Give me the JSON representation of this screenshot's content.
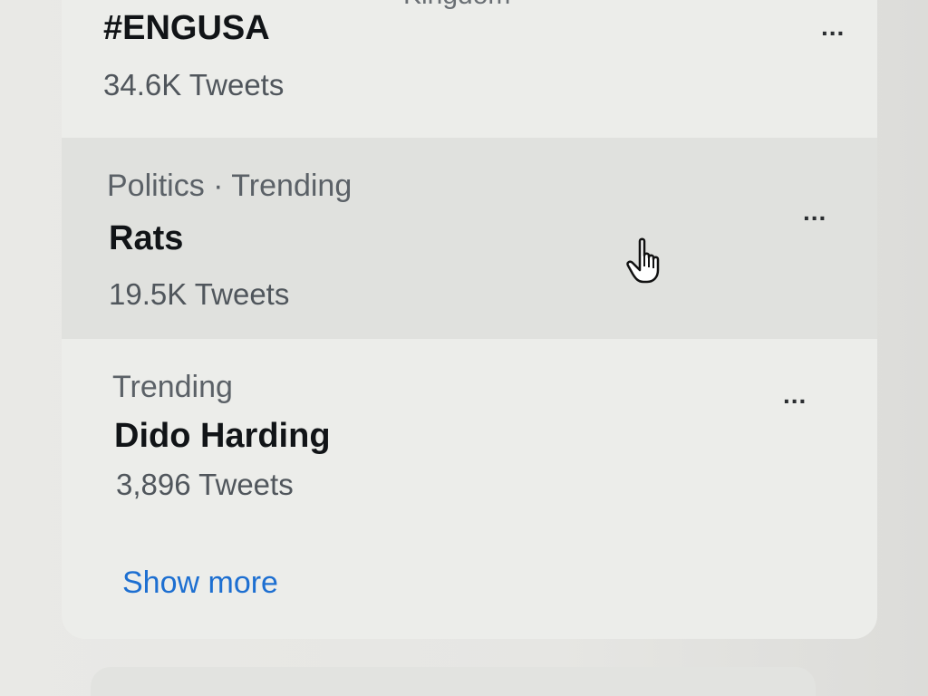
{
  "trends_panel": {
    "partial_header_text": "Kingdom",
    "items": [
      {
        "context": "",
        "name": "#ENGUSA",
        "count": "34.6K Tweets",
        "more_label": "..."
      },
      {
        "context": "Politics · Trending",
        "name": "Rats",
        "count": "19.5K Tweets",
        "more_label": "..."
      },
      {
        "context": "Trending",
        "name": "Dido Harding",
        "count": "3,896 Tweets",
        "more_label": "..."
      }
    ],
    "show_more_label": "Show more"
  },
  "colors": {
    "link": "#1d6fd1",
    "hover_row": "#e0e1de",
    "panel": "#ecedea"
  },
  "icons": {
    "more": "more-horizontal-icon",
    "cursor": "hand-pointer-cursor-icon"
  }
}
